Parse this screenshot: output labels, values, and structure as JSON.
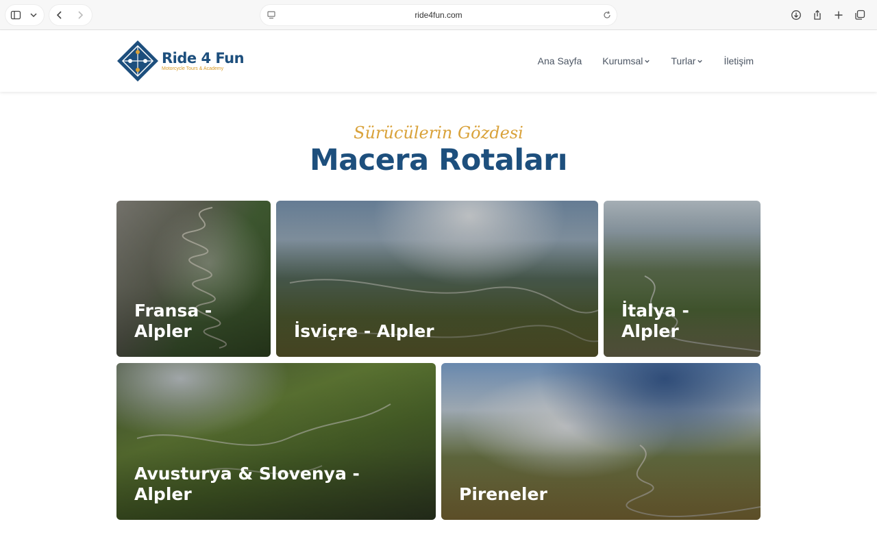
{
  "browser": {
    "url": "ride4fun.com"
  },
  "site": {
    "logo_name": "Ride 4 Fun",
    "logo_tagline": "Motorcycle Tours & Academy",
    "nav": [
      {
        "label": "Ana Sayfa",
        "has_dropdown": false
      },
      {
        "label": "Kurumsal",
        "has_dropdown": true
      },
      {
        "label": "Turlar",
        "has_dropdown": true
      },
      {
        "label": "İletişim",
        "has_dropdown": false
      }
    ]
  },
  "section": {
    "eyebrow": "Sürücülerin Gözdesi",
    "title": "Macera Rotaları"
  },
  "routes": [
    {
      "title": "Fransa - Alpler"
    },
    {
      "title": "İsviçre - Alpler"
    },
    {
      "title": "İtalya - Alpler"
    },
    {
      "title": "Avusturya & Slovenya - Alpler"
    },
    {
      "title": "Pireneler"
    }
  ],
  "colors": {
    "brand_blue": "#1d4f7d",
    "brand_gold": "#d9a23a"
  }
}
